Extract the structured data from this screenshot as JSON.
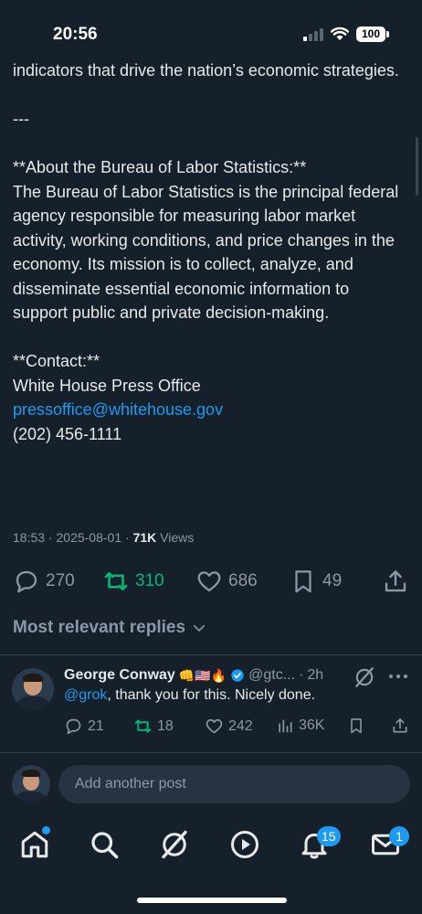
{
  "status_bar": {
    "time": "20:56",
    "battery": "100"
  },
  "post": {
    "lines": [
      "indicators that drive the nation’s economic strategies.",
      "",
      "---",
      "",
      "**About the Bureau of Labor Statistics:**",
      "The Bureau of Labor Statistics is the principal federal agency responsible for measuring labor market activity, working conditions, and price changes in the economy. Its mission is to collect, analyze, and disseminate essential economic information to support public and private decision-making.",
      "",
      "**Contact:**",
      "White House Press Office"
    ],
    "email": "pressoffice@whitehouse.gov",
    "phone": "(202) 456-1111",
    "meta": {
      "time": "18:53",
      "date": "2025-08-01",
      "views_count": "71K",
      "views_label": "Views"
    },
    "actions": {
      "replies": "270",
      "reposts": "310",
      "likes": "686",
      "bookmarks": "49"
    }
  },
  "replies_sort": {
    "label": "Most relevant replies"
  },
  "reply": {
    "name": "George Conway",
    "emojis": "👊🇺🇸🔥",
    "handle": "@gtc...",
    "age": "2h",
    "mention": "@grok",
    "text": ", thank you for this.  Nicely done.",
    "replies": "21",
    "reposts": "18",
    "likes": "242",
    "views": "36K"
  },
  "compose": {
    "placeholder": "Add another post"
  },
  "tabs": {
    "notifications_badge": "15",
    "messages_badge": "1"
  },
  "colors": {
    "background": "#15202b",
    "accent": "#1d9bf0",
    "repost": "#00ba7c",
    "muted": "#8b98a5"
  }
}
